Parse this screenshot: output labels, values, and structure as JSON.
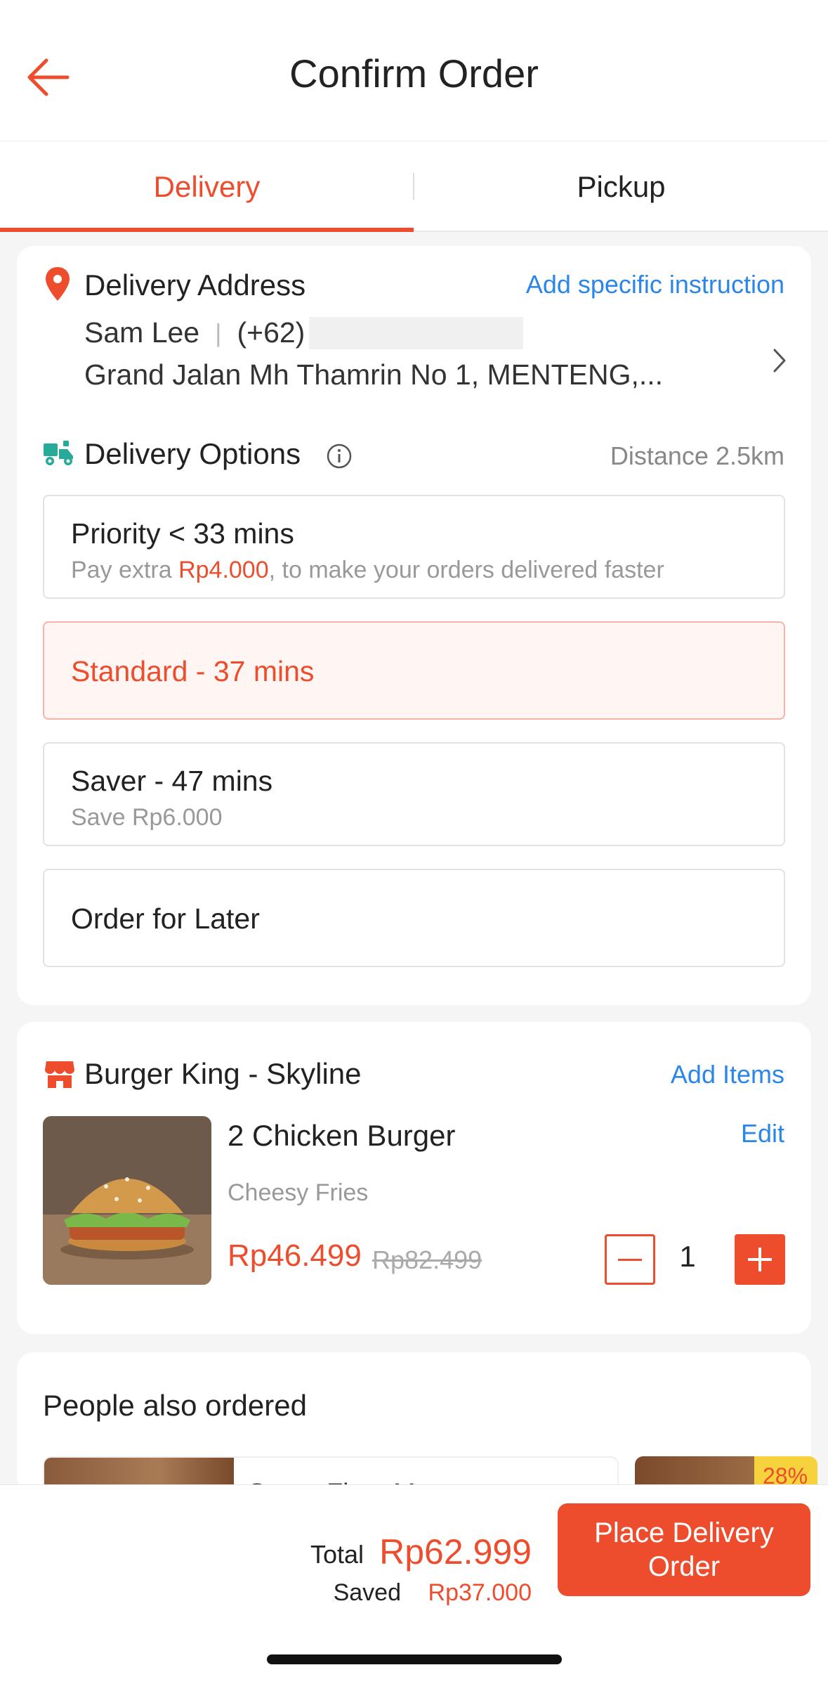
{
  "header": {
    "title": "Confirm Order"
  },
  "tabs": [
    {
      "label": "Delivery",
      "active": true
    },
    {
      "label": "Pickup",
      "active": false
    }
  ],
  "address": {
    "title": "Delivery Address",
    "instruction_link": "Add specific instruction",
    "name": "Sam Lee",
    "separator": "|",
    "phone_prefix": "(+62)",
    "street": "Grand Jalan Mh Thamrin No 1, MENTENG,..."
  },
  "delivery_options": {
    "title": "Delivery Options",
    "distance": "Distance 2.5km",
    "options": [
      {
        "title": "Priority < 33 mins",
        "sub_prefix": "Pay extra ",
        "sub_price": "Rp4.000",
        "sub_suffix": ", to make your orders delivered faster",
        "selected": false
      },
      {
        "title": "Standard - 37 mins",
        "selected": true
      },
      {
        "title": "Saver - 47 mins",
        "sub": "Save Rp6.000",
        "selected": false
      },
      {
        "title": "Order for Later",
        "selected": false
      }
    ]
  },
  "store": {
    "name": "Burger King - Skyline",
    "add_items": "Add Items",
    "item": {
      "title": "2 Chicken Burger",
      "option": "Cheesy Fries",
      "edit": "Edit",
      "price": "Rp46.499",
      "original_price": "Rp82.499",
      "quantity": "1"
    }
  },
  "people_also_ordered": {
    "title": "People also ordered",
    "items": [
      {
        "name": "Super Float Mango"
      },
      {
        "discount": "28%"
      }
    ]
  },
  "footer": {
    "total_label": "Total",
    "total_value": "Rp62.999",
    "saved_label": "Saved",
    "saved_value": "Rp37.000",
    "place_order": "Place Delivery Order"
  },
  "colors": {
    "accent": "#ee4d2d",
    "link": "#2a86e8",
    "delivery_icon": "#26aa99"
  }
}
